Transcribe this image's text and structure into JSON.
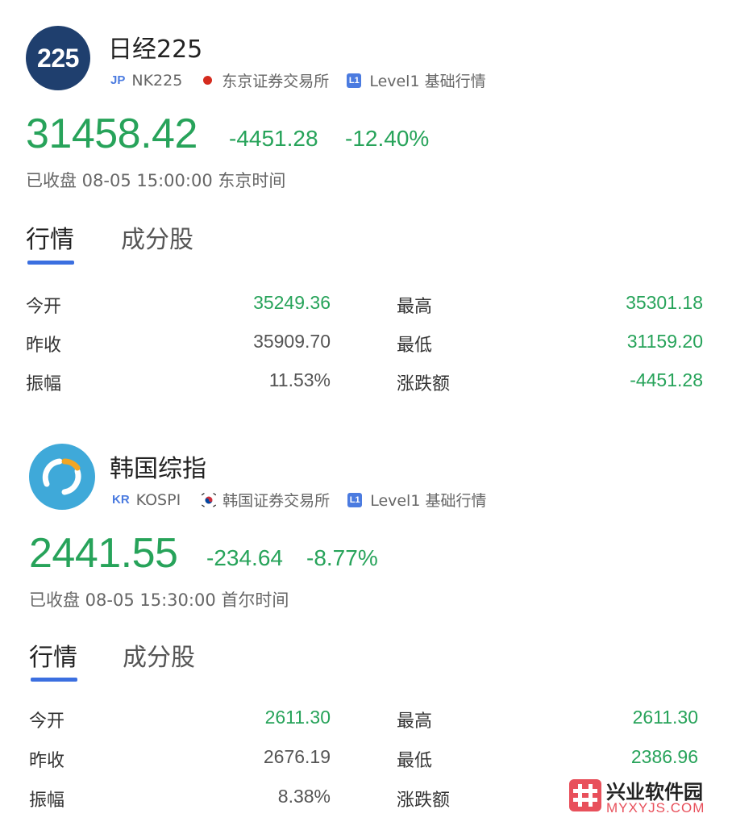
{
  "indices": [
    {
      "logo_text": "225",
      "name": "日经225",
      "market_code": "JP",
      "symbol": "NK225",
      "exchange": "东京证券交易所",
      "level_badge": "L1",
      "level": "Level1 基础行情",
      "price": "31458.42",
      "change": "-4451.28",
      "change_pct": "-12.40%",
      "status": "已收盘 08-05 15:00:00 东京时间",
      "tabs": [
        "行情",
        "成分股"
      ],
      "stats": {
        "open_label": "今开",
        "open": "35249.36",
        "high_label": "最高",
        "high": "35301.18",
        "prev_close_label": "昨收",
        "prev_close": "35909.70",
        "low_label": "最低",
        "low": "31159.20",
        "amplitude_label": "振幅",
        "amplitude": "11.53%",
        "change_amt_label": "涨跌额",
        "change_amt": "-4451.28"
      }
    },
    {
      "name": "韩国综指",
      "market_code": "KR",
      "symbol": "KOSPI",
      "exchange": "韩国证券交易所",
      "level_badge": "L1",
      "level": "Level1 基础行情",
      "price": "2441.55",
      "change": "-234.64",
      "change_pct": "-8.77%",
      "status": "已收盘 08-05 15:30:00 首尔时间",
      "tabs": [
        "行情",
        "成分股"
      ],
      "stats": {
        "open_label": "今开",
        "open": "2611.30",
        "high_label": "最高",
        "high": "2611.30",
        "prev_close_label": "昨收",
        "prev_close": "2676.19",
        "low_label": "最低",
        "low": "2386.96",
        "amplitude_label": "振幅",
        "amplitude": "8.38%",
        "change_amt_label": "涨跌额",
        "change_amt": ""
      }
    }
  ],
  "watermark": {
    "title": "兴业软件园",
    "url": "MYXYJS.COM"
  },
  "colors": {
    "up_down_green": "#27a35a",
    "accent_blue": "#3b6fe0",
    "n225_logo": "#1f3f6e",
    "kospi_logo": "#3fa9d9"
  }
}
